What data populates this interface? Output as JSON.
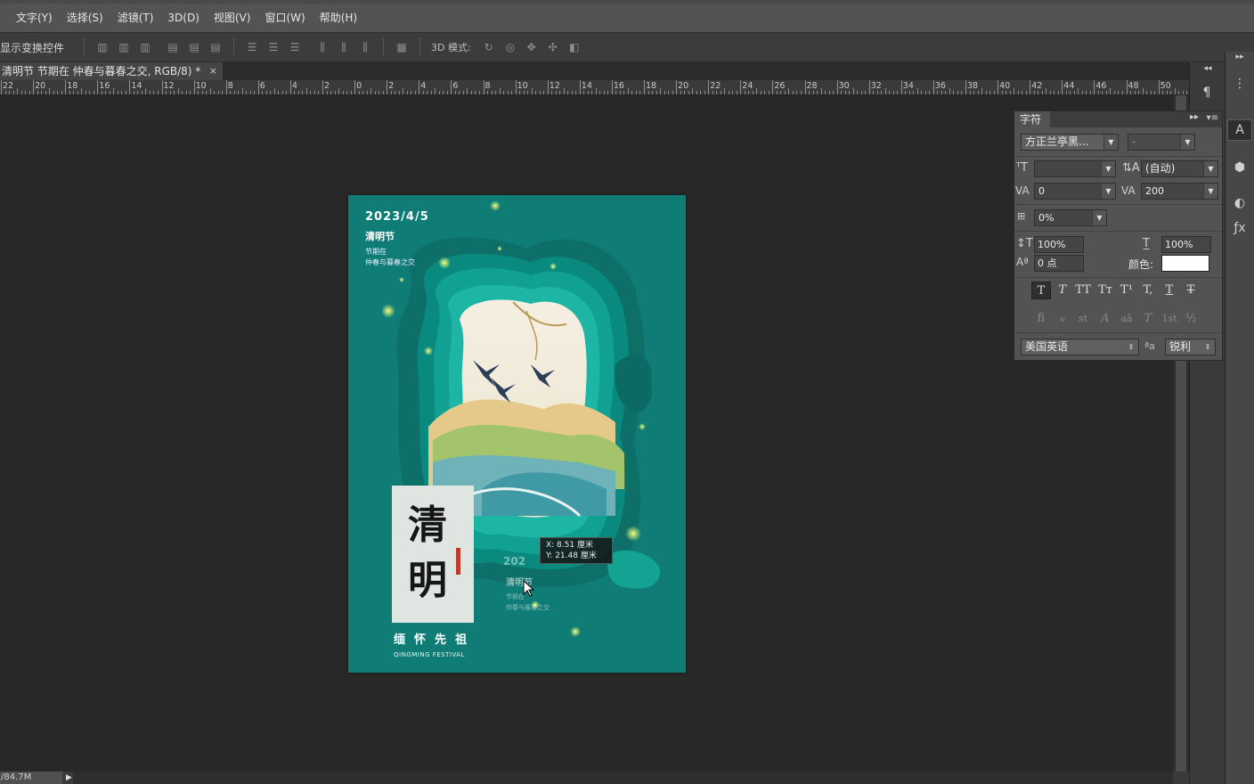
{
  "menu": [
    "文字(Y)",
    "选择(S)",
    "滤镜(T)",
    "3D(D)",
    "视图(V)",
    "窗口(W)",
    "帮助(H)"
  ],
  "options": {
    "show_transform": "显示变换控件",
    "mode_3d": "3D 模式:"
  },
  "doc_tab": {
    "title": "清明节 节期在 仲春与暮春之交, RGB/8) *",
    "close": "×"
  },
  "ruler": {
    "labels": [
      "22",
      "20",
      "18",
      "16",
      "14",
      "12",
      "10",
      "8",
      "6",
      "4",
      "2",
      "0",
      "2",
      "4",
      "6",
      "8",
      "10",
      "12",
      "14",
      "16",
      "18",
      "20",
      "22",
      "24",
      "26",
      "28",
      "30",
      "32",
      "34",
      "36",
      "38",
      "40",
      "42",
      "44",
      "46",
      "48",
      "50"
    ]
  },
  "poster": {
    "date": "2023/4/5",
    "festival": "清明节",
    "sub1": "节期在",
    "sub2": "仲春与暮春之交",
    "big1": "清",
    "big2": "明",
    "chars": "缅怀先祖",
    "english": "QINGMING FESTIVAL",
    "ghost_date": "202",
    "ghost_fest": "清明节",
    "ghost_sub1": "节期在",
    "ghost_sub2": "仲春与暮春之交",
    "bg_color": "#0f7c76"
  },
  "coord_tooltip": {
    "x_line": "X:   8.51 厘米",
    "y_line": "Y:  21.48 厘米"
  },
  "character_panel": {
    "tab": "字符",
    "font_family": "方正兰亭黑...",
    "font_style": "-",
    "font_size": "",
    "leading": "(自动)",
    "kerning": "0",
    "tracking": "200",
    "tsume": "0%",
    "vertical_scale": "100%",
    "horizontal_scale": "100%",
    "baseline_shift": "0 点",
    "color_label": "颜色:",
    "color": "#ffffff",
    "language": "美国英语",
    "aa_label": "ªa",
    "antialias": "锐利",
    "style_buttons": [
      "T",
      "T",
      "TT",
      "Tт",
      "T¹",
      "T,",
      "T",
      "T"
    ],
    "ot_buttons": [
      "ﬁ",
      "ℴ",
      "st",
      "A",
      "aā",
      "T",
      "1st",
      "½"
    ]
  },
  "status": {
    "zoom": "/84.7M",
    "arrow": "▶"
  }
}
